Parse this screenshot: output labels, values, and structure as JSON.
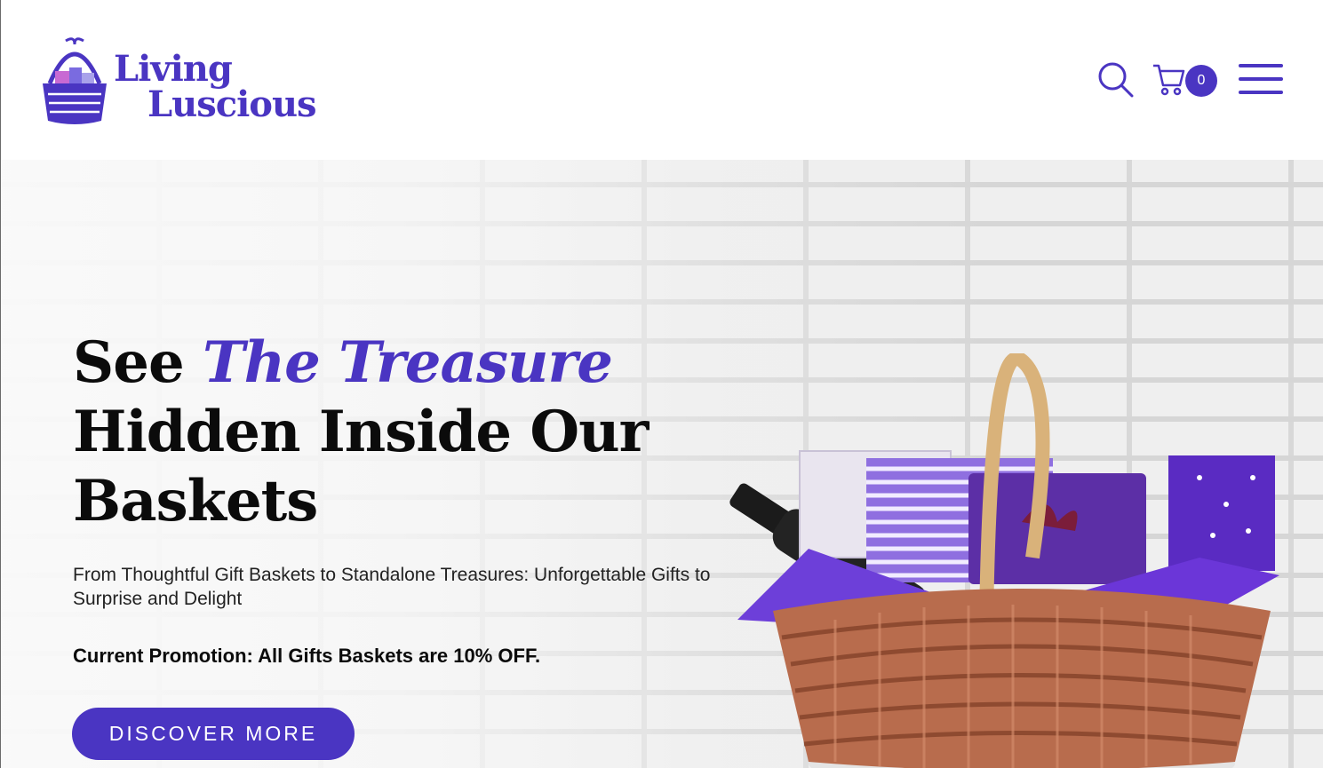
{
  "brand": {
    "line1": "Living",
    "line2": "Luscious",
    "accent_color": "#4a35c2"
  },
  "header": {
    "search_icon": "search-icon",
    "cart_icon": "cart-icon",
    "cart_count": "0",
    "menu_icon": "hamburger-menu-icon"
  },
  "hero": {
    "title_word1": "See",
    "title_accent": "The Treasure",
    "title_line2": "Hidden Inside Our",
    "title_line3": "Baskets",
    "subtitle": "From Thoughtful Gift Baskets to Standalone Treasures: Unforgettable Gifts to Surprise and Delight",
    "promotion": "Current Promotion: All Gifts Baskets are 10% OFF.",
    "cta_label": "DISCOVER MORE"
  }
}
